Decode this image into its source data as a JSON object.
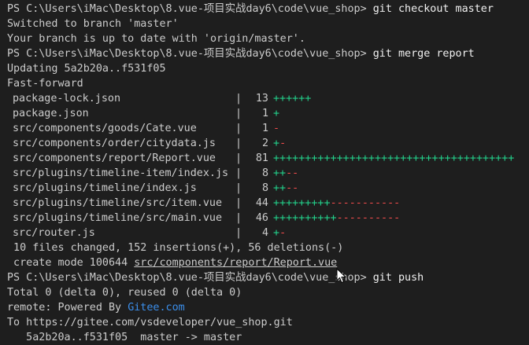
{
  "terminal": {
    "prompt": "PS C:\\Users\\iMac\\Desktop\\8.vue-项目实战day6\\code\\vue_shop> ",
    "commands": {
      "checkout": {
        "git": "git",
        "rest": " checkout master"
      },
      "merge": {
        "git": "git",
        "rest": " merge report"
      },
      "push": {
        "git": "git",
        "rest": " push"
      }
    },
    "checkout_output": [
      "Switched to branch 'master'",
      "Your branch is up to date with 'origin/master'."
    ],
    "merge_output": {
      "updating": "Updating 5a2b20a..f531f05",
      "fast_forward": "Fast-forward",
      "stats": [
        {
          "file": "package-lock.json",
          "count": "13",
          "plus": "++++++",
          "minus": ""
        },
        {
          "file": "package.json",
          "count": "1",
          "plus": "+",
          "minus": ""
        },
        {
          "file": "src/components/goods/Cate.vue",
          "count": "1",
          "plus": "",
          "minus": "-"
        },
        {
          "file": "src/components/order/citydata.js",
          "count": "2",
          "plus": "+",
          "minus": "-"
        },
        {
          "file": "src/components/report/Report.vue",
          "count": "81",
          "plus": "++++++++++++++++++++++++++++++++++++++",
          "minus": ""
        },
        {
          "file": "src/plugins/timeline-item/index.js",
          "count": "8",
          "plus": "++",
          "minus": "--"
        },
        {
          "file": "src/plugins/timeline/index.js",
          "count": "8",
          "plus": "++",
          "minus": "--"
        },
        {
          "file": "src/plugins/timeline/src/item.vue",
          "count": "44",
          "plus": "+++++++++",
          "minus": "-----------"
        },
        {
          "file": "src/plugins/timeline/src/main.vue",
          "count": "46",
          "plus": "++++++++++",
          "minus": "----------"
        },
        {
          "file": "src/router.js",
          "count": "4",
          "plus": "+",
          "minus": "-"
        }
      ],
      "summary": " 10 files changed, 152 insertions(+), 56 deletions(-)",
      "create_prefix": " create mode 100644 ",
      "create_path": "src/components/report/Report.vue"
    },
    "push_output": {
      "total": "Total 0 (delta 0), reused 0 (delta 0)",
      "remote_prefix": "remote: Powered By ",
      "remote_link": "Gitee.com",
      "to": "To https://gitee.com/vsdeveloper/vue_shop.git",
      "ref_update": "   5a2b20a..f531f05  master -> master"
    },
    "stat_separator": "|"
  },
  "colors": {
    "background": "#1e1e1e",
    "text": "#cccccc",
    "insertion": "#23d18b",
    "deletion": "#f14c4c",
    "link": "#3b8eea"
  }
}
